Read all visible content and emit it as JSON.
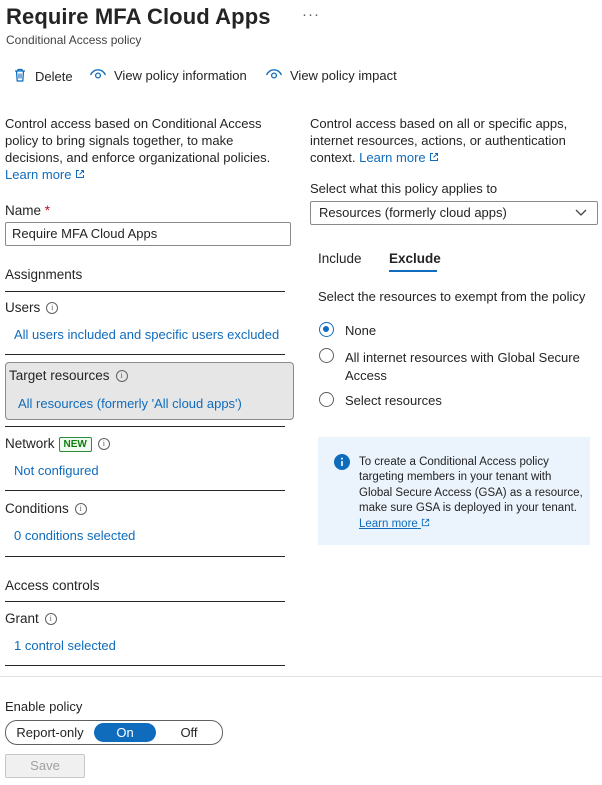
{
  "header": {
    "title": "Require MFA Cloud Apps",
    "more": "···",
    "subtitle": "Conditional Access policy"
  },
  "toolbar": {
    "delete_label": "Delete",
    "view_info_label": "View policy information",
    "view_impact_label": "View policy impact"
  },
  "left": {
    "intro": "Control access based on Conditional Access policy to bring signals together, to make decisions, and enforce organizational policies.",
    "learn_more": "Learn more",
    "name_label": "Name",
    "name_required": "*",
    "name_value": "Require MFA Cloud Apps",
    "assignments_heading": "Assignments",
    "users_label": "Users",
    "users_value": "All users included and specific users excluded",
    "target_label": "Target resources",
    "target_value": "All resources (formerly 'All cloud apps')",
    "network_label": "Network",
    "network_badge": "NEW",
    "network_value": "Not configured",
    "conditions_label": "Conditions",
    "conditions_value": "0 conditions selected",
    "access_heading": "Access controls",
    "grant_label": "Grant",
    "grant_value": "1 control selected"
  },
  "right": {
    "intro": "Control access based on all or specific apps, internet resources, actions, or authentication context.",
    "learn_more": "Learn more",
    "applies_label": "Select what this policy applies to",
    "applies_value": "Resources (formerly cloud apps)",
    "tabs": [
      "Include",
      "Exclude"
    ],
    "active_tab": "Exclude",
    "exempt_label": "Select the resources to exempt from the policy",
    "options": [
      "None",
      "All internet resources with Global Secure Access",
      "Select resources"
    ],
    "selected_option": "None",
    "info_text": "To create a Conditional Access policy targeting members in your tenant with Global Secure Access (GSA) as a resource, make sure GSA is deployed in your tenant.",
    "info_link": "Learn more"
  },
  "footer": {
    "enable_label": "Enable policy",
    "toggle": [
      "Report-only",
      "On",
      "Off"
    ],
    "toggle_selected": "On",
    "save_label": "Save"
  },
  "colors": {
    "accent": "#0f6cbd",
    "selected_bg": "#e6e6e6",
    "info_bg": "#ebf3fc",
    "badge_green": "#107c10"
  }
}
